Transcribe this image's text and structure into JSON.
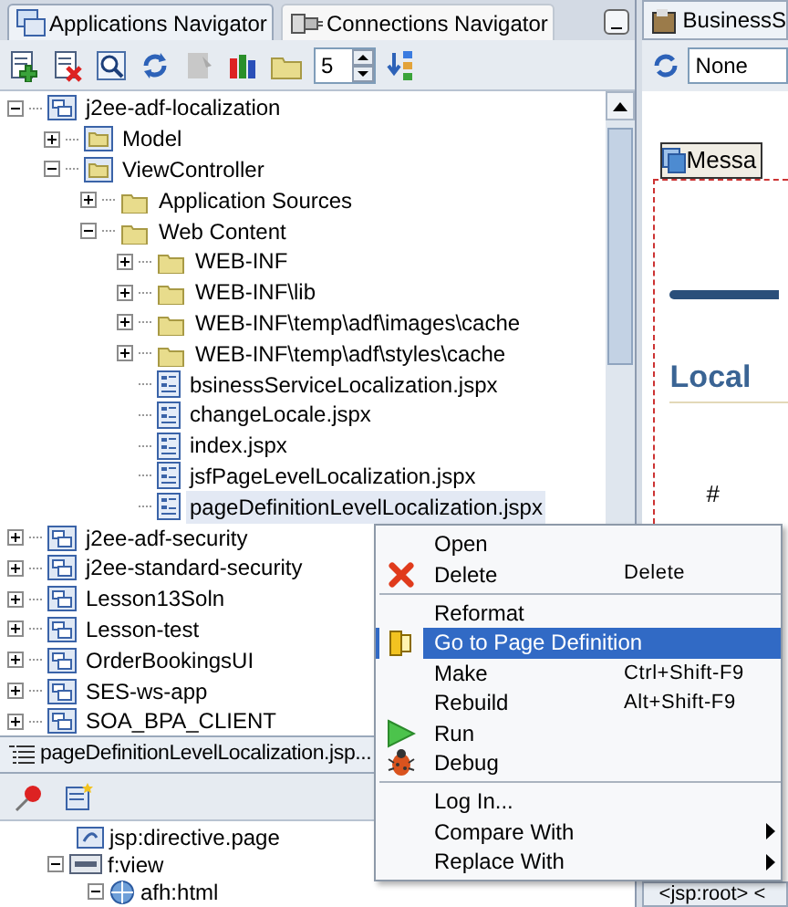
{
  "navigator_tabs": [
    {
      "label": "Applications Navigator",
      "selected": true
    },
    {
      "label": "Connections Navigator",
      "selected": false
    }
  ],
  "toolbar": {
    "spinner_value": "5"
  },
  "tree": [
    {
      "label": "j2ee-adf-localization",
      "kind": "project",
      "expanded": true,
      "children": [
        {
          "label": "Model",
          "kind": "module",
          "expanded": false
        },
        {
          "label": "ViewController",
          "kind": "module",
          "expanded": true,
          "children": [
            {
              "label": "Application Sources",
              "kind": "folder",
              "expanded": false
            },
            {
              "label": "Web Content",
              "kind": "folder",
              "expanded": true,
              "children": [
                {
                  "label": "WEB-INF",
                  "kind": "folder",
                  "expanded": false
                },
                {
                  "label": "WEB-INF\\lib",
                  "kind": "folder",
                  "expanded": false
                },
                {
                  "label": "WEB-INF\\temp\\adf\\images\\cache",
                  "kind": "folder",
                  "expanded": false
                },
                {
                  "label": "WEB-INF\\temp\\adf\\styles\\cache",
                  "kind": "folder",
                  "expanded": false
                },
                {
                  "label": "bsinessServiceLocalization.jspx",
                  "kind": "file",
                  "selected": false
                },
                {
                  "label": "changeLocale.jspx",
                  "kind": "file",
                  "selected": false
                },
                {
                  "label": "index.jspx",
                  "kind": "file",
                  "selected": false
                },
                {
                  "label": "jsfPageLevelLocalization.jspx",
                  "kind": "file",
                  "selected": false
                },
                {
                  "label": "pageDefinitionLevelLocalization.jspx",
                  "kind": "file",
                  "selected": true
                }
              ]
            }
          ]
        }
      ]
    },
    {
      "label": "j2ee-adf-security",
      "kind": "project",
      "expanded": false
    },
    {
      "label": "j2ee-standard-security",
      "kind": "project",
      "expanded": false
    },
    {
      "label": "Lesson13Soln",
      "kind": "project",
      "expanded": false
    },
    {
      "label": "Lesson-test",
      "kind": "project",
      "expanded": false
    },
    {
      "label": "OrderBookingsUI",
      "kind": "project",
      "expanded": false
    },
    {
      "label": "SES-ws-app",
      "kind": "project",
      "expanded": false
    },
    {
      "label": "SOA_BPA_CLIENT",
      "kind": "project",
      "expanded": false
    }
  ],
  "structure_panel": {
    "title": "pageDefinitionLevelLocalization.jsp...",
    "tree": [
      {
        "label": "jsp:directive.page",
        "kind": "directive"
      },
      {
        "label": "f:view",
        "kind": "jsf",
        "expanded": true
      },
      {
        "label": "afh:html",
        "kind": "html",
        "expanded": true
      }
    ]
  },
  "editor": {
    "tab": "BusinessS",
    "dropdown": "None",
    "component": "Messa",
    "heading": "Local",
    "hash": "#",
    "source_tab": "<jsp:root> <"
  },
  "context_menu": [
    {
      "kind": "item",
      "label": "Open",
      "selected": false
    },
    {
      "kind": "delete",
      "label": "Delete",
      "shortcut": "Delete",
      "selected": false
    },
    {
      "kind": "separator"
    },
    {
      "kind": "item",
      "label": "Reformat",
      "selected": false
    },
    {
      "kind": "goto",
      "label": "Go to Page Definition",
      "selected": true
    },
    {
      "kind": "item",
      "label": "Make",
      "shortcut": "Ctrl+Shift-F9",
      "selected": false
    },
    {
      "kind": "item",
      "label": "Rebuild",
      "shortcut": "Alt+Shift-F9",
      "selected": false
    },
    {
      "kind": "run",
      "label": "Run",
      "selected": false
    },
    {
      "kind": "debug",
      "label": "Debug",
      "selected": false
    },
    {
      "kind": "separator"
    },
    {
      "kind": "item",
      "label": "Log In...",
      "selected": false
    },
    {
      "kind": "submenu",
      "label": "Compare With",
      "selected": false
    },
    {
      "kind": "submenu",
      "label": "Replace With",
      "selected": false
    }
  ]
}
